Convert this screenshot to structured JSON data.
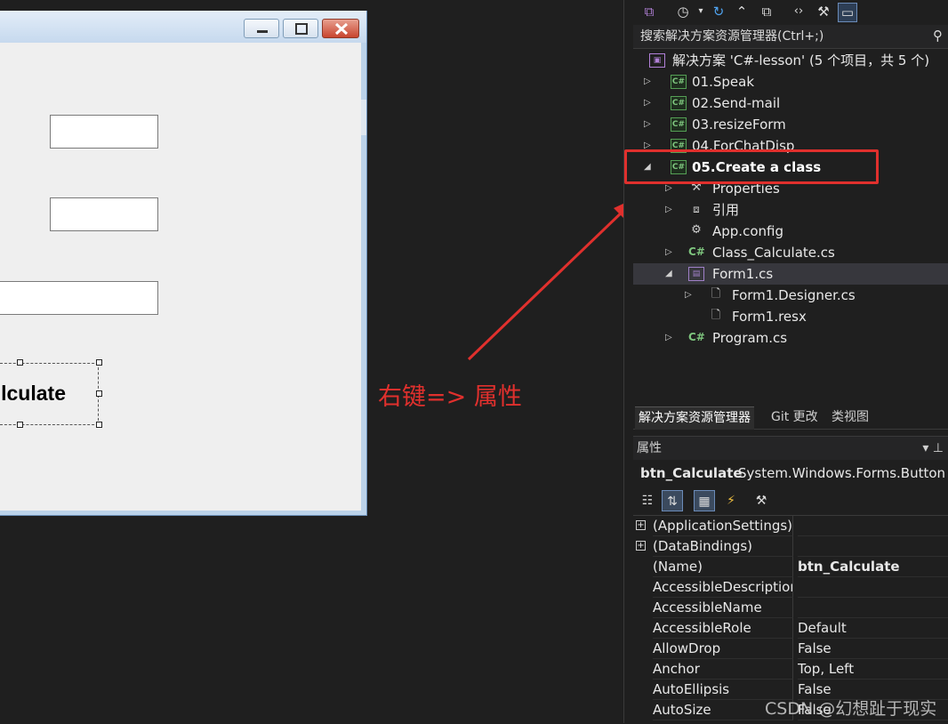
{
  "form": {
    "button_label": "lculate"
  },
  "annotation": {
    "text": "右键=> 属性",
    "color": "#e0302d"
  },
  "search": {
    "placeholder": "搜索解决方案资源管理器(Ctrl+;)"
  },
  "tree": {
    "solution": "解决方案 'C#-lesson' (5 个项目，共 5 个)",
    "projects": [
      {
        "label": "01.Speak",
        "icon": "C#"
      },
      {
        "label": "02.Send-mail",
        "icon": "C#"
      },
      {
        "label": "03.resizeForm",
        "icon": "C#"
      },
      {
        "label": "04.ForChatDisp",
        "icon": "C#"
      },
      {
        "label": "05.Create a class",
        "icon": "C#"
      }
    ],
    "children": [
      {
        "label": "Properties"
      },
      {
        "label": "引用"
      },
      {
        "label": "App.config"
      },
      {
        "label": "Class_Calculate.cs",
        "icon": "C#"
      },
      {
        "label": "Form1.cs"
      },
      {
        "label": "Form1.Designer.cs"
      },
      {
        "label": "Form1.resx"
      },
      {
        "label": "Program.cs",
        "icon": "C#"
      }
    ]
  },
  "tabs": [
    "解决方案资源管理器",
    "Git 更改",
    "类视图"
  ],
  "properties": {
    "title": "属性",
    "object_name": "btn_Calculate",
    "object_type": "System.Windows.Forms.Button",
    "rows": [
      {
        "name": "(ApplicationSettings)",
        "value": "",
        "expandable": true
      },
      {
        "name": "(DataBindings)",
        "value": "",
        "expandable": true
      },
      {
        "name": "(Name)",
        "value": "btn_Calculate",
        "bold": true
      },
      {
        "name": "AccessibleDescriptior",
        "value": ""
      },
      {
        "name": "AccessibleName",
        "value": ""
      },
      {
        "name": "AccessibleRole",
        "value": "Default"
      },
      {
        "name": "AllowDrop",
        "value": "False"
      },
      {
        "name": "Anchor",
        "value": "Top, Left"
      },
      {
        "name": "AutoEllipsis",
        "value": "False"
      },
      {
        "name": "AutoSize",
        "value": "False"
      }
    ]
  },
  "watermark": "CSDN @幻想趾于现实",
  "icons": {
    "toolbar": [
      "vs-logo-icon",
      "history-icon",
      "dropdown-icon",
      "refresh-icon",
      "collapse-icon",
      "copy-icon",
      "code-icon",
      "wrench-icon",
      "preview-icon"
    ],
    "plus": "+"
  }
}
